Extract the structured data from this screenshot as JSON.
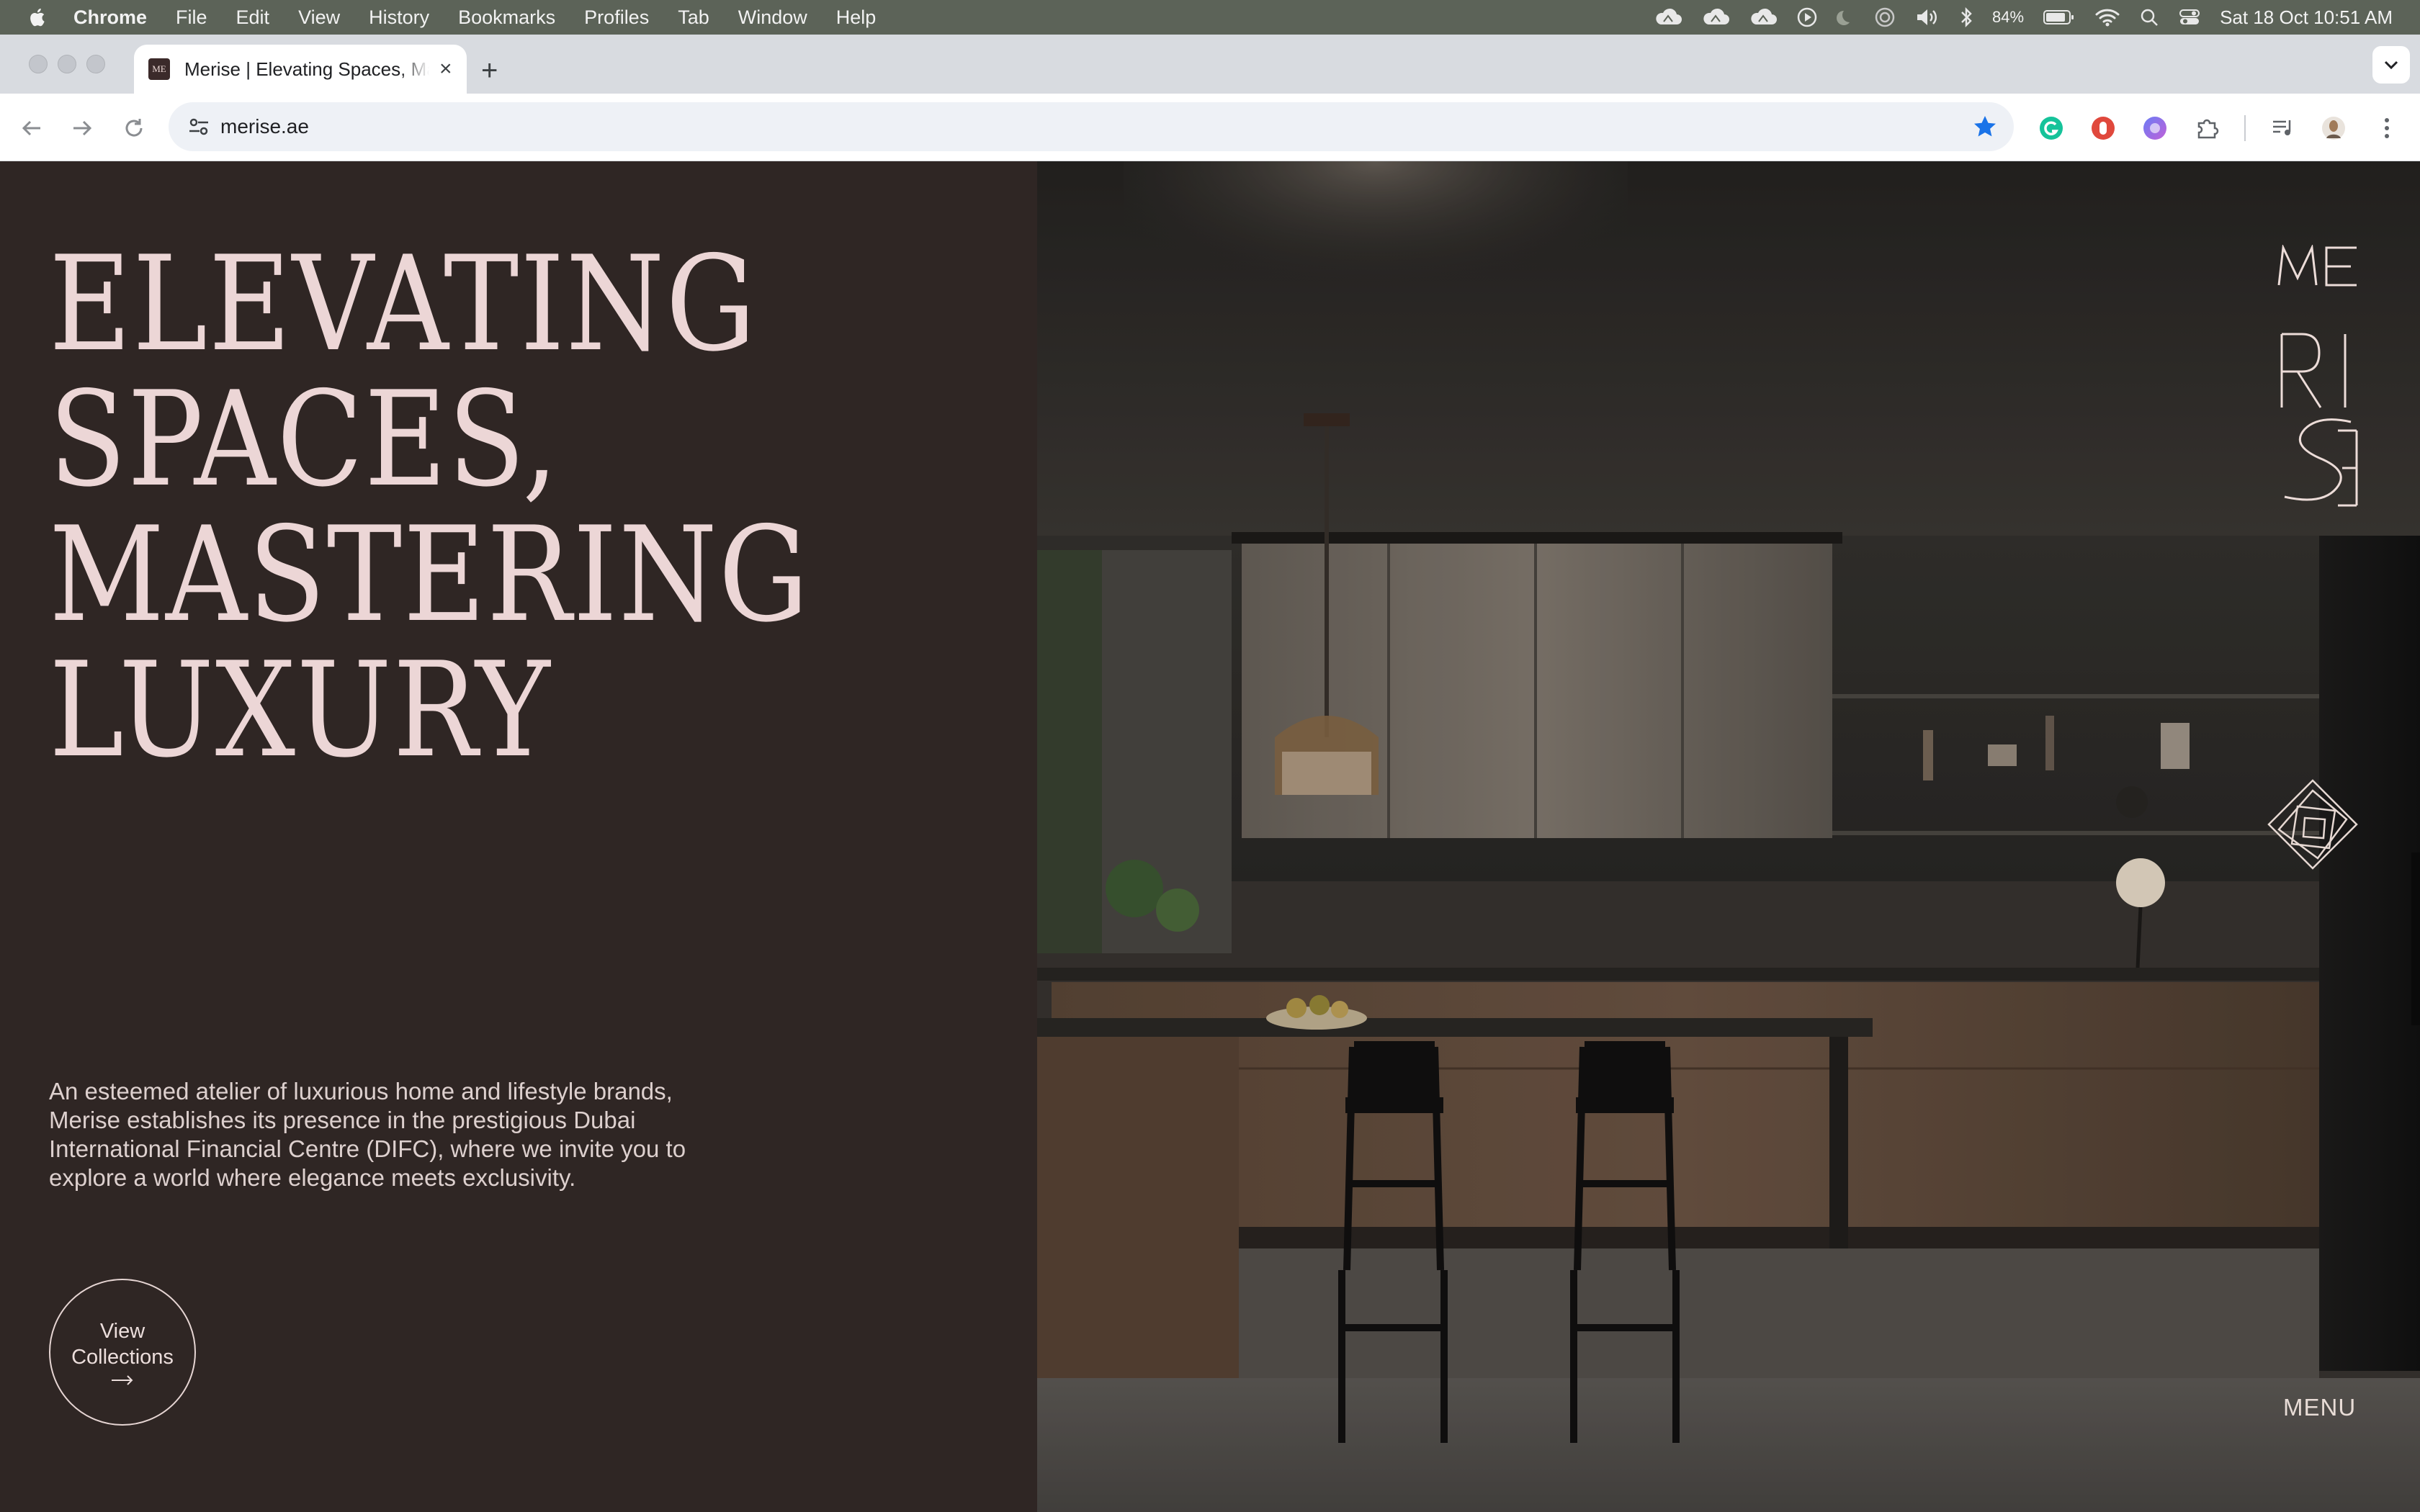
{
  "menubar": {
    "app_name": "Chrome",
    "items": [
      "File",
      "Edit",
      "View",
      "History",
      "Bookmarks",
      "Profiles",
      "Tab",
      "Window",
      "Help"
    ],
    "battery": "84%",
    "datetime": "Sat 18 Oct  10:51 AM"
  },
  "browser": {
    "tab_title": "Merise | Elevating Spaces, Mastering Luxury",
    "favicon_text": "ME",
    "url": "merise.ae"
  },
  "page": {
    "headline": [
      "ELEVATING",
      "SPACES,",
      "MASTERING",
      "LUXURY"
    ],
    "intro": "An esteemed atelier of luxurious home and lifestyle brands, Merise establishes its presence in the prestigious Dubai International Financial Centre (DIFC), where we invite you to explore a world where elegance meets exclusivity.",
    "cta_label": "View Collections",
    "menu_label": "MENU",
    "logo_text": "MERISE"
  },
  "colors": {
    "panel_bg": "#2f2624",
    "headline": "#ecd6d6",
    "accent_star": "#1a73e8"
  },
  "icons": {
    "apple": "apple-logo-icon",
    "back": "back-arrow-icon",
    "forward": "forward-arrow-icon",
    "reload": "reload-icon",
    "site_info": "site-settings-icon",
    "bookmark": "star-icon",
    "extensions": [
      "grammarly-extension-icon",
      "red-extension-icon",
      "purple-extension-icon",
      "puzzle-extensions-icon",
      "media-controls-icon",
      "profile-avatar-icon",
      "kebab-menu-icon"
    ]
  }
}
